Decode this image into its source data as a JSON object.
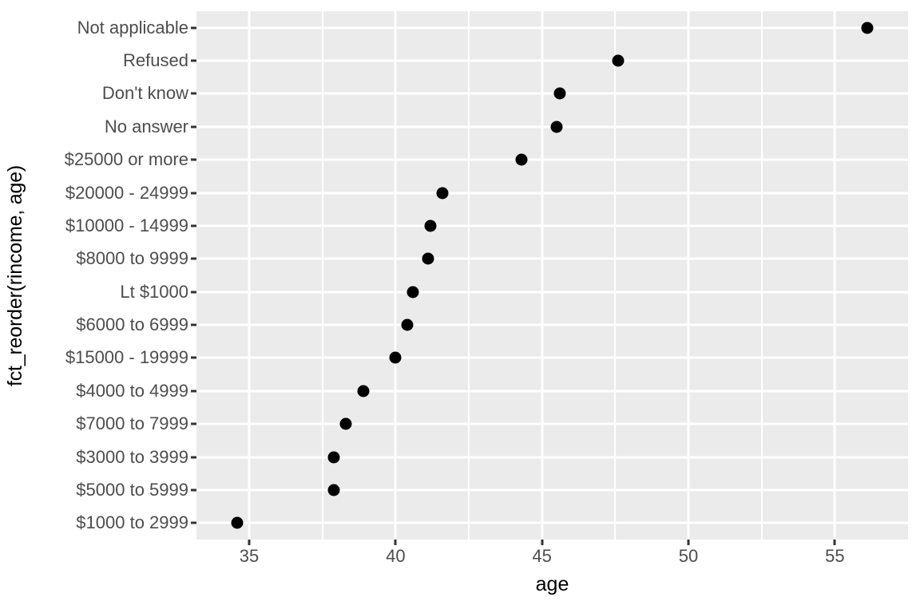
{
  "chart_data": {
    "type": "scatter",
    "title": "",
    "xlabel": "age",
    "ylabel": "fct_reorder(rincome, age)",
    "xlim": [
      33.2,
      57.5
    ],
    "grid": true,
    "legend": null,
    "x_ticks": [
      {
        "label": "35",
        "value": 35
      },
      {
        "label": "40",
        "value": 40
      },
      {
        "label": "45",
        "value": 45
      },
      {
        "label": "50",
        "value": 50
      },
      {
        "label": "55",
        "value": 55
      }
    ],
    "x_minor_ticks": [
      37.5,
      42.5,
      47.5,
      52.5
    ],
    "categories": [
      "Not applicable",
      "Refused",
      "Don't know",
      "No answer",
      "$25000 or more",
      "$20000 - 24999",
      "$10000 - 14999",
      "$8000 to 9999",
      "Lt $1000",
      "$6000 to 6999",
      "$15000 - 19999",
      "$4000 to 4999",
      "$7000 to 7999",
      "$3000 to 3999",
      "$5000 to 5999",
      "$1000 to 2999"
    ],
    "values": [
      56.1,
      47.6,
      45.6,
      45.5,
      44.3,
      41.6,
      41.2,
      41.1,
      40.6,
      40.4,
      40.0,
      38.9,
      38.3,
      37.9,
      37.9,
      34.6
    ],
    "point_color": "#000000",
    "panel_color": "#ebebeb",
    "grid_color": "#ffffff"
  }
}
